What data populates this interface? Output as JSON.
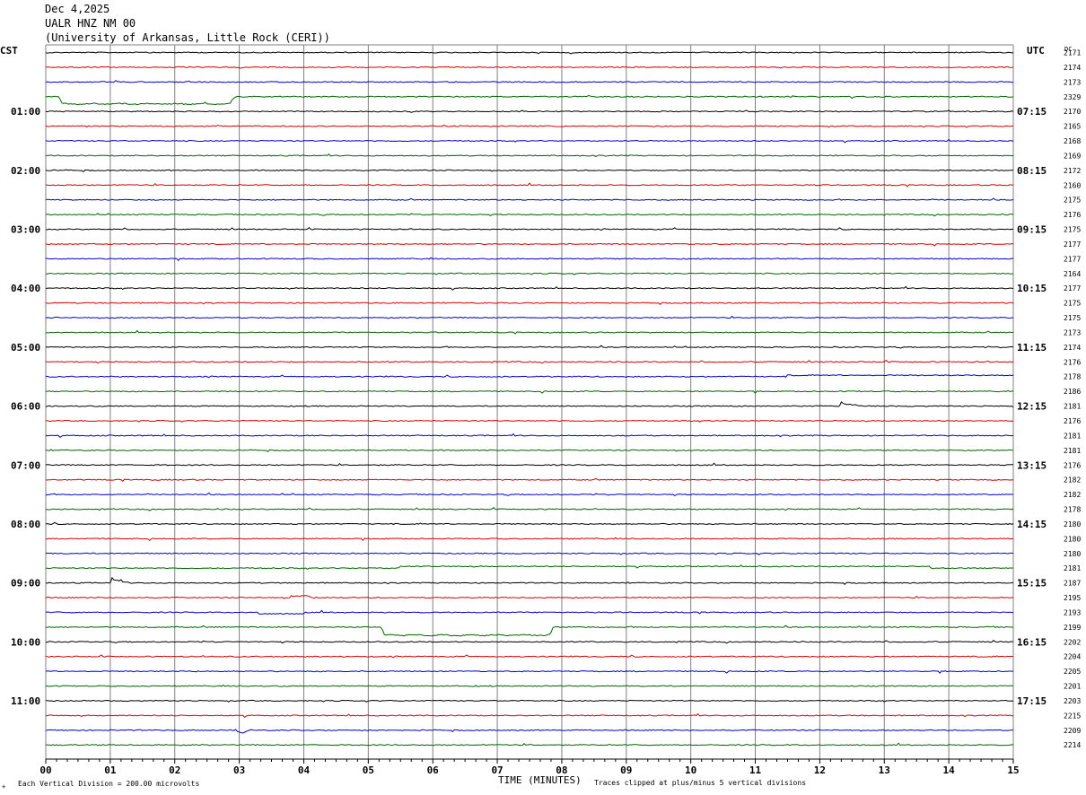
{
  "header": {
    "date": "Dec 4,2025",
    "station": "UALR HNZ NM 00",
    "institution": "(University of Arkansas, Little Rock (CERI))"
  },
  "left_axis_title": "CST",
  "right_axis_title": "UTC",
  "dc_title": "DC",
  "bottom": {
    "xlabel": "TIME (MINUTES)",
    "scale_note": "Each Vertical Division =  200.00 microvolts",
    "clip_note": "Traces clipped at plus/minus 5 vertical divisions",
    "corner_mark": "+"
  },
  "colors": {
    "trace_cycle": [
      "#000000",
      "#d40000",
      "#0000c8",
      "#006400"
    ],
    "grid": "#808080"
  },
  "chart_data": {
    "type": "line",
    "subtype": "helicorder",
    "x": [
      "00",
      "01",
      "02",
      "03",
      "04",
      "05",
      "06",
      "07",
      "08",
      "09",
      "10",
      "11",
      "12",
      "13",
      "14",
      "15"
    ],
    "xlim": [
      0,
      15
    ],
    "minutes_per_line": 15,
    "lines": 48,
    "left_time_labels": [
      {
        "line": 4,
        "text": "01:00"
      },
      {
        "line": 8,
        "text": "02:00"
      },
      {
        "line": 12,
        "text": "03:00"
      },
      {
        "line": 16,
        "text": "04:00"
      },
      {
        "line": 20,
        "text": "05:00"
      },
      {
        "line": 24,
        "text": "06:00"
      },
      {
        "line": 28,
        "text": "07:00"
      },
      {
        "line": 32,
        "text": "08:00"
      },
      {
        "line": 36,
        "text": "09:00"
      },
      {
        "line": 40,
        "text": "10:00"
      },
      {
        "line": 44,
        "text": "11:00"
      }
    ],
    "right_time_labels": [
      {
        "line": 4,
        "text": "07:15"
      },
      {
        "line": 8,
        "text": "08:15"
      },
      {
        "line": 12,
        "text": "09:15"
      },
      {
        "line": 16,
        "text": "10:15"
      },
      {
        "line": 20,
        "text": "11:15"
      },
      {
        "line": 24,
        "text": "12:15"
      },
      {
        "line": 28,
        "text": "13:15"
      },
      {
        "line": 32,
        "text": "14:15"
      },
      {
        "line": 36,
        "text": "15:15"
      },
      {
        "line": 40,
        "text": "16:15"
      },
      {
        "line": 44,
        "text": "17:15"
      }
    ],
    "dc_offsets": [
      "2171",
      "2174",
      "2173",
      "2329",
      "2170",
      "2165",
      "2168",
      "2169",
      "2172",
      "2160",
      "2175",
      "2176",
      "2175",
      "2177",
      "2177",
      "2164",
      "2177",
      "2175",
      "2175",
      "2173",
      "2174",
      "2176",
      "2178",
      "2186",
      "2181",
      "2176",
      "2181",
      "2181",
      "2176",
      "2182",
      "2182",
      "2178",
      "2180",
      "2180",
      "2180",
      "2181",
      "2187",
      "2195",
      "2193",
      "2199",
      "2202",
      "2204",
      "2205",
      "2201",
      "2203",
      "2215",
      "2209",
      "2214"
    ],
    "events": [
      {
        "line": 3,
        "start": 0.2,
        "end": 2.95,
        "shape": "step_down",
        "amplitude": 8
      },
      {
        "line": 36,
        "start": 1.0,
        "end": 1.3,
        "shape": "bump_up",
        "amplitude": 6
      },
      {
        "line": 39,
        "start": 5.2,
        "end": 7.9,
        "shape": "step_down",
        "amplitude": 9
      },
      {
        "line": 24,
        "start": 12.3,
        "end": 12.7,
        "shape": "bump_up",
        "amplitude": 5
      },
      {
        "line": 35,
        "start": 5.5,
        "end": 13.7,
        "shape": "raise",
        "amplitude": 2
      },
      {
        "line": 22,
        "start": 11.5,
        "end": 15.0,
        "shape": "raise",
        "amplitude": 1.5
      },
      {
        "line": 37,
        "start": 3.8,
        "end": 4.1,
        "shape": "raise",
        "amplitude": 2
      },
      {
        "line": 38,
        "start": 3.3,
        "end": 4.0,
        "shape": "lower",
        "amplitude": 1.5
      },
      {
        "line": 46,
        "start": 2.95,
        "end": 3.15,
        "shape": "dip",
        "amplitude": 3
      }
    ]
  }
}
